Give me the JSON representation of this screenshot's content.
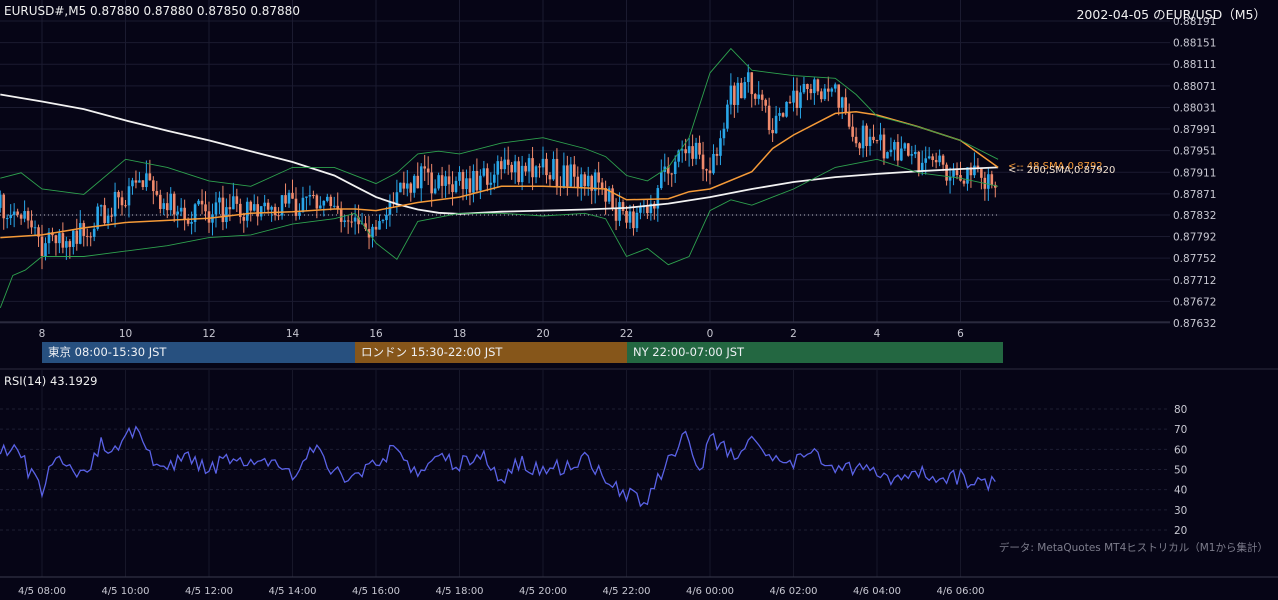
{
  "header": {
    "symbol_info": "EURUSD#,M5 0.87880 0.87880 0.87850 0.87880",
    "title": "2002-04-05 のEUR/USD（M5）"
  },
  "sessions": [
    {
      "label": "東京 08:00-15:30 JST",
      "color": "#27507f"
    },
    {
      "label": "ロンドン 15:30-22:00 JST",
      "color": "#86561a"
    },
    {
      "label": "NY 22:00-07:00 JST",
      "color": "#236741"
    }
  ],
  "rsi_title": "RSI(14) 43.1929",
  "footer_note": "データ: MetaQuotes MT4ヒストリカル（M1から集計）",
  "colors": {
    "background": "#060516",
    "bull": "#29a6e8",
    "bear": "#f08a6c",
    "sma200": "#f2f2f2",
    "sma48": "#f59a38",
    "bollinger": "#2ea14e",
    "rsi": "#5a62e6"
  },
  "chart_data": [
    {
      "type": "candlestick",
      "title": "2002-04-05 のEUR/USD（M5）",
      "y_tick_labels": [
        "0.88191",
        "0.88151",
        "0.88111",
        "0.88071",
        "0.88031",
        "0.87991",
        "0.87951",
        "0.87911",
        "0.87871",
        "0.87832",
        "0.87792",
        "0.87752",
        "0.87712",
        "0.87672",
        "0.87632"
      ],
      "ylim": [
        0.87632,
        0.88191
      ],
      "x_tick_labels": [
        "8",
        "10",
        "12",
        "14",
        "16",
        "18",
        "20",
        "22",
        "0",
        "2",
        "4",
        "6"
      ],
      "reference_line": 0.87832,
      "series": [
        {
          "name": "200,SMA,0.87920",
          "label": "<-- 200,SMA,0.87920",
          "kind": "line",
          "hours": [
            7.0,
            8.0,
            9.0,
            10.0,
            11.0,
            12.0,
            13.0,
            14.0,
            15.0,
            15.5,
            16.0,
            16.5,
            17.0,
            17.5,
            18.0,
            19.0,
            20.0,
            21.0,
            22.0,
            23.0,
            24.0,
            25.0,
            26.0,
            27.0,
            28.0,
            29.0,
            30.0,
            30.9
          ],
          "values": [
            0.88055,
            0.88042,
            0.88028,
            0.88007,
            0.87988,
            0.8797,
            0.8795,
            0.8793,
            0.87905,
            0.87885,
            0.87865,
            0.87852,
            0.87842,
            0.87836,
            0.87834,
            0.87838,
            0.8784,
            0.87842,
            0.87845,
            0.87853,
            0.87865,
            0.8788,
            0.87893,
            0.87902,
            0.87908,
            0.87913,
            0.87917,
            0.8792
          ]
        },
        {
          "name": "48,SMA",
          "label": "<-- 48,SMA,0.8792",
          "kind": "line",
          "hours": [
            7.0,
            8.0,
            9.0,
            10.0,
            11.0,
            12.0,
            13.0,
            14.0,
            15.0,
            15.5,
            16.0,
            17.0,
            18.0,
            19.0,
            20.0,
            21.0,
            21.5,
            22.0,
            23.0,
            23.5,
            24.0,
            25.0,
            25.5,
            26.0,
            26.5,
            27.0,
            27.5,
            28.0,
            29.0,
            30.0,
            30.9
          ],
          "values": [
            0.8779,
            0.87795,
            0.87808,
            0.87818,
            0.87822,
            0.87826,
            0.87835,
            0.87838,
            0.87843,
            0.87843,
            0.8784,
            0.87855,
            0.87865,
            0.87885,
            0.87885,
            0.87882,
            0.8788,
            0.8786,
            0.87862,
            0.87875,
            0.8788,
            0.87912,
            0.87955,
            0.8798,
            0.88,
            0.8802,
            0.88023,
            0.88017,
            0.87995,
            0.8797,
            0.8792
          ]
        },
        {
          "name": "BB upper",
          "kind": "line",
          "hours": [
            7.0,
            7.5,
            8.0,
            9.0,
            10.0,
            11.0,
            12.0,
            13.0,
            14.0,
            15.0,
            16.0,
            16.5,
            17.0,
            17.5,
            18.0,
            19.0,
            20.0,
            21.0,
            21.5,
            22.0,
            22.5,
            23.0,
            23.5,
            24.0,
            24.5,
            25.0,
            25.5,
            26.0,
            27.0,
            27.5,
            28.0,
            29.0,
            30.0,
            30.9
          ],
          "values": [
            0.879,
            0.8791,
            0.8788,
            0.8787,
            0.87935,
            0.8792,
            0.87895,
            0.87885,
            0.8792,
            0.8792,
            0.8789,
            0.8791,
            0.87945,
            0.8795,
            0.87945,
            0.87965,
            0.87975,
            0.87955,
            0.8794,
            0.87905,
            0.87895,
            0.8792,
            0.87975,
            0.88095,
            0.8814,
            0.881,
            0.88095,
            0.8809,
            0.88085,
            0.88055,
            0.88015,
            0.87995,
            0.8797,
            0.87935
          ]
        },
        {
          "name": "BB lower",
          "kind": "line",
          "hours": [
            7.0,
            7.3,
            7.6,
            8.0,
            9.0,
            10.0,
            11.0,
            12.0,
            13.0,
            14.0,
            15.0,
            15.5,
            16.0,
            16.5,
            17.0,
            18.0,
            19.0,
            20.0,
            21.0,
            21.5,
            22.0,
            22.5,
            23.0,
            23.5,
            24.0,
            24.5,
            25.0,
            25.5,
            26.0,
            27.0,
            28.0,
            29.0,
            30.0,
            30.9
          ],
          "values": [
            0.8766,
            0.8772,
            0.8773,
            0.87755,
            0.87755,
            0.87765,
            0.87775,
            0.8779,
            0.87795,
            0.87815,
            0.87825,
            0.87835,
            0.8778,
            0.8775,
            0.8782,
            0.87835,
            0.87835,
            0.8783,
            0.87835,
            0.87825,
            0.87755,
            0.8777,
            0.8774,
            0.87755,
            0.8784,
            0.8786,
            0.8785,
            0.87865,
            0.8788,
            0.8792,
            0.87935,
            0.8791,
            0.879,
            0.87885
          ]
        }
      ],
      "candle_hours_start": 7.0,
      "candle_hours_end": 30.9,
      "candle_close_path": [
        [
          7.0,
          0.87845
        ],
        [
          7.5,
          0.8783
        ],
        [
          8.0,
          0.8778
        ],
        [
          8.7,
          0.87795
        ],
        [
          9.0,
          0.878
        ],
        [
          9.5,
          0.8784
        ],
        [
          10.0,
          0.8787
        ],
        [
          10.5,
          0.8789
        ],
        [
          11.0,
          0.8785
        ],
        [
          11.5,
          0.8783
        ],
        [
          12.0,
          0.8784
        ],
        [
          12.5,
          0.87845
        ],
        [
          13.0,
          0.8784
        ],
        [
          13.5,
          0.8785
        ],
        [
          14.0,
          0.8785
        ],
        [
          14.5,
          0.87865
        ],
        [
          15.0,
          0.87845
        ],
        [
          15.5,
          0.8782
        ],
        [
          15.8,
          0.878
        ],
        [
          16.0,
          0.8782
        ],
        [
          16.5,
          0.8787
        ],
        [
          17.0,
          0.879
        ],
        [
          17.5,
          0.8789
        ],
        [
          18.0,
          0.8789
        ],
        [
          18.5,
          0.879
        ],
        [
          19.0,
          0.87915
        ],
        [
          19.5,
          0.8791
        ],
        [
          20.0,
          0.8792
        ],
        [
          20.5,
          0.87905
        ],
        [
          21.0,
          0.879
        ],
        [
          21.5,
          0.8788
        ],
        [
          22.0,
          0.8781
        ],
        [
          22.5,
          0.8784
        ],
        [
          23.0,
          0.8792
        ],
        [
          23.5,
          0.8797
        ],
        [
          24.0,
          0.879
        ],
        [
          24.5,
          0.8805
        ],
        [
          25.0,
          0.8808
        ],
        [
          25.5,
          0.88
        ],
        [
          26.0,
          0.8805
        ],
        [
          26.5,
          0.8806
        ],
        [
          27.0,
          0.8805
        ],
        [
          27.5,
          0.8798
        ],
        [
          28.0,
          0.8796
        ],
        [
          28.5,
          0.8795
        ],
        [
          29.0,
          0.8793
        ],
        [
          29.5,
          0.8792
        ],
        [
          30.0,
          0.8791
        ],
        [
          30.5,
          0.879
        ],
        [
          30.9,
          0.8788
        ]
      ]
    },
    {
      "type": "line",
      "title": "RSI(14) 43.1929",
      "y_tick_labels": [
        "80",
        "70",
        "60",
        "50",
        "40",
        "30",
        "20"
      ],
      "ylim": [
        20,
        80
      ],
      "series": [
        {
          "name": "RSI(14)",
          "hours": [
            7.0,
            7.4,
            7.8,
            8.0,
            8.4,
            8.8,
            9.0,
            9.4,
            9.8,
            10.0,
            10.2,
            10.6,
            11.0,
            11.5,
            12.0,
            12.5,
            13.0,
            13.5,
            14.0,
            14.5,
            15.0,
            15.5,
            16.0,
            16.5,
            17.0,
            17.5,
            18.0,
            18.5,
            19.0,
            19.5,
            20.0,
            20.5,
            21.0,
            21.5,
            22.0,
            22.4,
            22.8,
            23.0,
            23.4,
            23.8,
            24.0,
            24.4,
            24.8,
            25.0,
            25.3,
            25.6,
            26.0,
            26.5,
            27.0,
            27.5,
            28.0,
            28.5,
            29.0,
            29.5,
            30.0,
            30.5,
            30.9
          ],
          "values": [
            58,
            60,
            45,
            40,
            58,
            45,
            46,
            62,
            60,
            68,
            70,
            55,
            52,
            57,
            49,
            56,
            52,
            54,
            47,
            60,
            50,
            45,
            54,
            60,
            48,
            56,
            52,
            58,
            46,
            54,
            48,
            52,
            55,
            45,
            38,
            32,
            46,
            55,
            67,
            48,
            66,
            60,
            55,
            68,
            60,
            57,
            54,
            58,
            48,
            52,
            47,
            46,
            49,
            45,
            46,
            42,
            43
          ]
        }
      ]
    }
  ],
  "x_axis_time_labels": [
    "4/5 08:00",
    "4/5 10:00",
    "4/5 12:00",
    "4/5 14:00",
    "4/5 16:00",
    "4/5 18:00",
    "4/5 20:00",
    "4/5 22:00",
    "4/6 00:00",
    "4/6 02:00",
    "4/6 04:00",
    "4/6 06:00"
  ]
}
